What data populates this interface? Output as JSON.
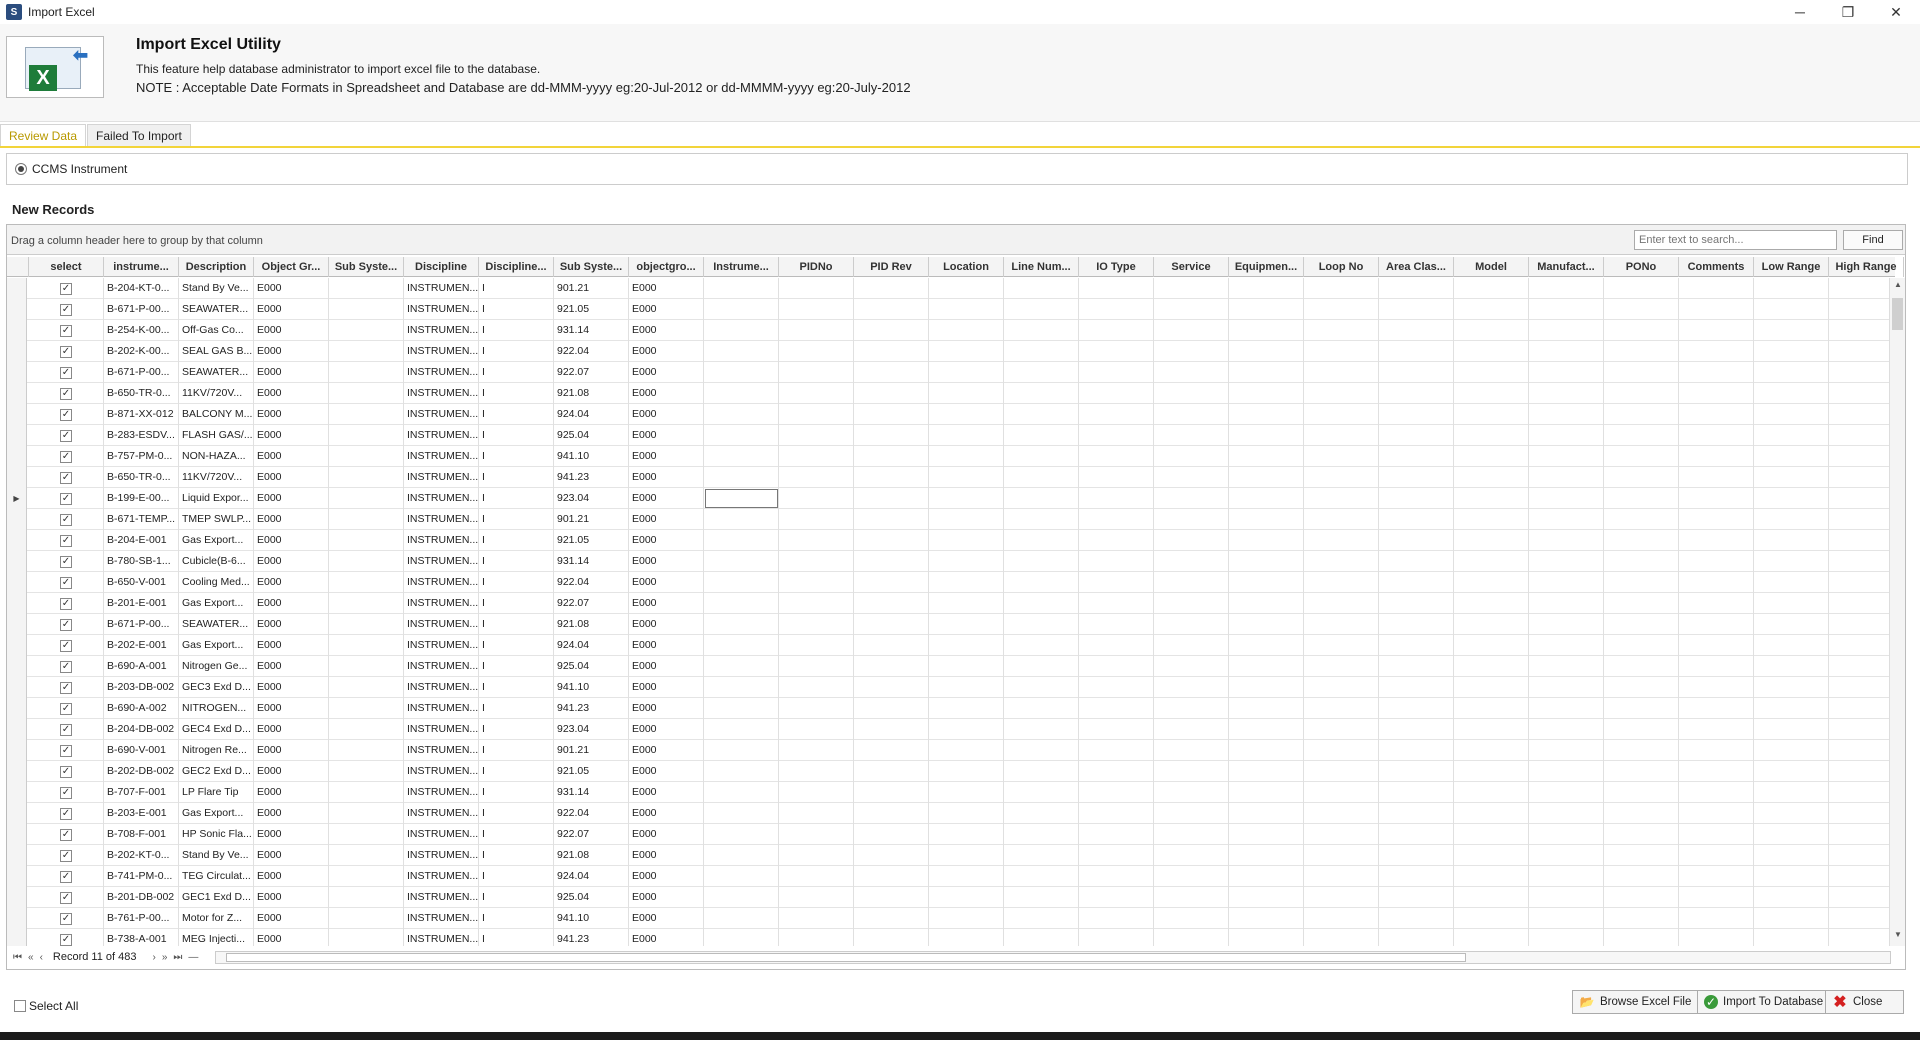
{
  "window": {
    "title": "Import Excel",
    "app_icon": "S",
    "minimize": "─",
    "restore": "❐",
    "close": "✕"
  },
  "header": {
    "title": "Import Excel Utility",
    "description": "This feature help database administrator to import excel file to the database.",
    "note": "NOTE : Acceptable Date Formats in Spreadsheet and Database are dd-MMM-yyyy eg:20-Jul-2012 or dd-MMMM-yyyy eg:20-July-2012"
  },
  "tabs": [
    "Review Data",
    "Failed To Import"
  ],
  "radio": {
    "label": "CCMS Instrument"
  },
  "section_title": "New Records",
  "grid": {
    "group_hint": "Drag a column header here to group by that column",
    "search_placeholder": "Enter text to search...",
    "find_label": "Find",
    "columns": [
      "select",
      "instrume...",
      "Description",
      "Object Gr...",
      "Sub Syste...",
      "Discipline",
      "Discipline...",
      "Sub Syste...",
      "objectgro...",
      "Instrume...",
      "PIDNo",
      "PID Rev",
      "Location",
      "Line Num...",
      "IO Type",
      "Service",
      "Equipmen...",
      "Loop No",
      "Area Clas...",
      "Model",
      "Manufact...",
      "PONo",
      "Comments",
      "Low Range",
      "High Range"
    ],
    "rows": [
      [
        "B-204-KT-0...",
        "Stand By Ve...",
        "E000",
        "",
        "INSTRUMEN...",
        "I",
        "901.21",
        "E000"
      ],
      [
        "B-671-P-00...",
        "SEAWATER...",
        "E000",
        "",
        "INSTRUMEN...",
        "I",
        "921.05",
        "E000"
      ],
      [
        "B-254-K-00...",
        "Off-Gas Co...",
        "E000",
        "",
        "INSTRUMEN...",
        "I",
        "931.14",
        "E000"
      ],
      [
        "B-202-K-00...",
        "SEAL GAS B...",
        "E000",
        "",
        "INSTRUMEN...",
        "I",
        "922.04",
        "E000"
      ],
      [
        "B-671-P-00...",
        "SEAWATER...",
        "E000",
        "",
        "INSTRUMEN...",
        "I",
        "922.07",
        "E000"
      ],
      [
        "B-650-TR-0...",
        "11KV/720V...",
        "E000",
        "",
        "INSTRUMEN...",
        "I",
        "921.08",
        "E000"
      ],
      [
        "B-871-XX-012",
        "BALCONY M...",
        "E000",
        "",
        "INSTRUMEN...",
        "I",
        "924.04",
        "E000"
      ],
      [
        "B-283-ESDV...",
        "FLASH GAS/...",
        "E000",
        "",
        "INSTRUMEN...",
        "I",
        "925.04",
        "E000"
      ],
      [
        "B-757-PM-0...",
        "NON-HAZA...",
        "E000",
        "",
        "INSTRUMEN...",
        "I",
        "941.10",
        "E000"
      ],
      [
        "B-650-TR-0...",
        "11KV/720V...",
        "E000",
        "",
        "INSTRUMEN...",
        "I",
        "941.23",
        "E000"
      ],
      [
        "B-199-E-00...",
        "Liquid Expor...",
        "E000",
        "",
        "INSTRUMEN...",
        "I",
        "923.04",
        "E000"
      ],
      [
        "B-671-TEMP...",
        "TMEP SWLP...",
        "E000",
        "",
        "INSTRUMEN...",
        "I",
        "901.21",
        "E000"
      ],
      [
        "B-204-E-001",
        "Gas Export...",
        "E000",
        "",
        "INSTRUMEN...",
        "I",
        "921.05",
        "E000"
      ],
      [
        "B-780-SB-1...",
        "Cubicle(B-6...",
        "E000",
        "",
        "INSTRUMEN...",
        "I",
        "931.14",
        "E000"
      ],
      [
        "B-650-V-001",
        "Cooling Med...",
        "E000",
        "",
        "INSTRUMEN...",
        "I",
        "922.04",
        "E000"
      ],
      [
        "B-201-E-001",
        "Gas Export...",
        "E000",
        "",
        "INSTRUMEN...",
        "I",
        "922.07",
        "E000"
      ],
      [
        "B-671-P-00...",
        "SEAWATER...",
        "E000",
        "",
        "INSTRUMEN...",
        "I",
        "921.08",
        "E000"
      ],
      [
        "B-202-E-001",
        "Gas Export...",
        "E000",
        "",
        "INSTRUMEN...",
        "I",
        "924.04",
        "E000"
      ],
      [
        "B-690-A-001",
        "Nitrogen Ge...",
        "E000",
        "",
        "INSTRUMEN...",
        "I",
        "925.04",
        "E000"
      ],
      [
        "B-203-DB-002",
        "GEC3 Exd D...",
        "E000",
        "",
        "INSTRUMEN...",
        "I",
        "941.10",
        "E000"
      ],
      [
        "B-690-A-002",
        "NITROGEN...",
        "E000",
        "",
        "INSTRUMEN...",
        "I",
        "941.23",
        "E000"
      ],
      [
        "B-204-DB-002",
        "GEC4 Exd D...",
        "E000",
        "",
        "INSTRUMEN...",
        "I",
        "923.04",
        "E000"
      ],
      [
        "B-690-V-001",
        "Nitrogen Re...",
        "E000",
        "",
        "INSTRUMEN...",
        "I",
        "901.21",
        "E000"
      ],
      [
        "B-202-DB-002",
        "GEC2 Exd D...",
        "E000",
        "",
        "INSTRUMEN...",
        "I",
        "921.05",
        "E000"
      ],
      [
        "B-707-F-001",
        "LP Flare Tip",
        "E000",
        "",
        "INSTRUMEN...",
        "I",
        "931.14",
        "E000"
      ],
      [
        "B-203-E-001",
        "Gas Export...",
        "E000",
        "",
        "INSTRUMEN...",
        "I",
        "922.04",
        "E000"
      ],
      [
        "B-708-F-001",
        "HP Sonic Fla...",
        "E000",
        "",
        "INSTRUMEN...",
        "I",
        "922.07",
        "E000"
      ],
      [
        "B-202-KT-0...",
        "Stand By Ve...",
        "E000",
        "",
        "INSTRUMEN...",
        "I",
        "921.08",
        "E000"
      ],
      [
        "B-741-PM-0...",
        "TEG Circulat...",
        "E000",
        "",
        "INSTRUMEN...",
        "I",
        "924.04",
        "E000"
      ],
      [
        "B-201-DB-002",
        "GEC1 Exd D...",
        "E000",
        "",
        "INSTRUMEN...",
        "I",
        "925.04",
        "E000"
      ],
      [
        "B-761-P-00...",
        "Motor for Z...",
        "E000",
        "",
        "INSTRUMEN...",
        "I",
        "941.10",
        "E000"
      ],
      [
        "B-738-A-001",
        "MEG Injecti...",
        "E000",
        "",
        "INSTRUMEN...",
        "I",
        "941.23",
        "E000"
      ]
    ],
    "checked": true,
    "focused_row_index": 10,
    "record_text": "Record 11 of 483",
    "nav_symbols": [
      "⏮",
      "«",
      "‹",
      "›",
      "»",
      "⏭",
      "—"
    ]
  },
  "footer": {
    "select_all": "Select All",
    "browse_label": "Browse Excel File",
    "import_label": "Import To Database",
    "close_label": "Close"
  },
  "icons": {
    "browse": "folder-icon",
    "import": "check-circle-icon",
    "close": "red-x-icon"
  }
}
